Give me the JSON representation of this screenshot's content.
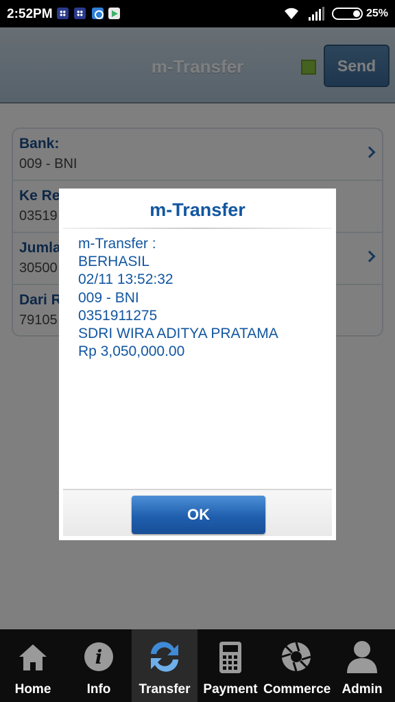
{
  "status_bar": {
    "time": "2:52PM",
    "battery": "25%",
    "notification_icons": [
      "bbm-icon",
      "bbm-icon",
      "bbm-circle-icon",
      "play-store-icon"
    ],
    "system_icons": [
      "wifi-icon",
      "signal-icon",
      "battery-icon"
    ]
  },
  "header": {
    "title": "m-Transfer",
    "send_label": "Send",
    "indicator_color": "#8bc43d"
  },
  "form": {
    "rows": [
      {
        "label": "Bank:",
        "value": "009 - BNI",
        "has_chevron": true
      },
      {
        "label": "Ke Re",
        "value": "03519",
        "has_chevron": false
      },
      {
        "label": "Jumla",
        "value": "30500",
        "has_chevron": true
      },
      {
        "label": "Dari R",
        "value": "79105",
        "has_chevron": false
      }
    ]
  },
  "dialog": {
    "title": "m-Transfer",
    "lines": [
      "m-Transfer :",
      "BERHASIL",
      "02/11 13:52:32",
      "009 - BNI",
      "0351911275",
      "SDRI WIRA ADITYA PRATAMA",
      "Rp 3,050,000.00"
    ],
    "ok_label": "OK"
  },
  "nav": {
    "active": "Transfer",
    "items": [
      {
        "label": "Home",
        "icon": "home-icon"
      },
      {
        "label": "Info",
        "icon": "info-icon"
      },
      {
        "label": "Transfer",
        "icon": "transfer-icon"
      },
      {
        "label": "Payment",
        "icon": "payment-icon"
      },
      {
        "label": "Commerce",
        "icon": "commerce-icon"
      },
      {
        "label": "Admin",
        "icon": "admin-icon"
      }
    ]
  },
  "colors": {
    "accent": "#1256a0",
    "ok_button": "#1f5fae",
    "header_bg": "#aec4d6"
  }
}
